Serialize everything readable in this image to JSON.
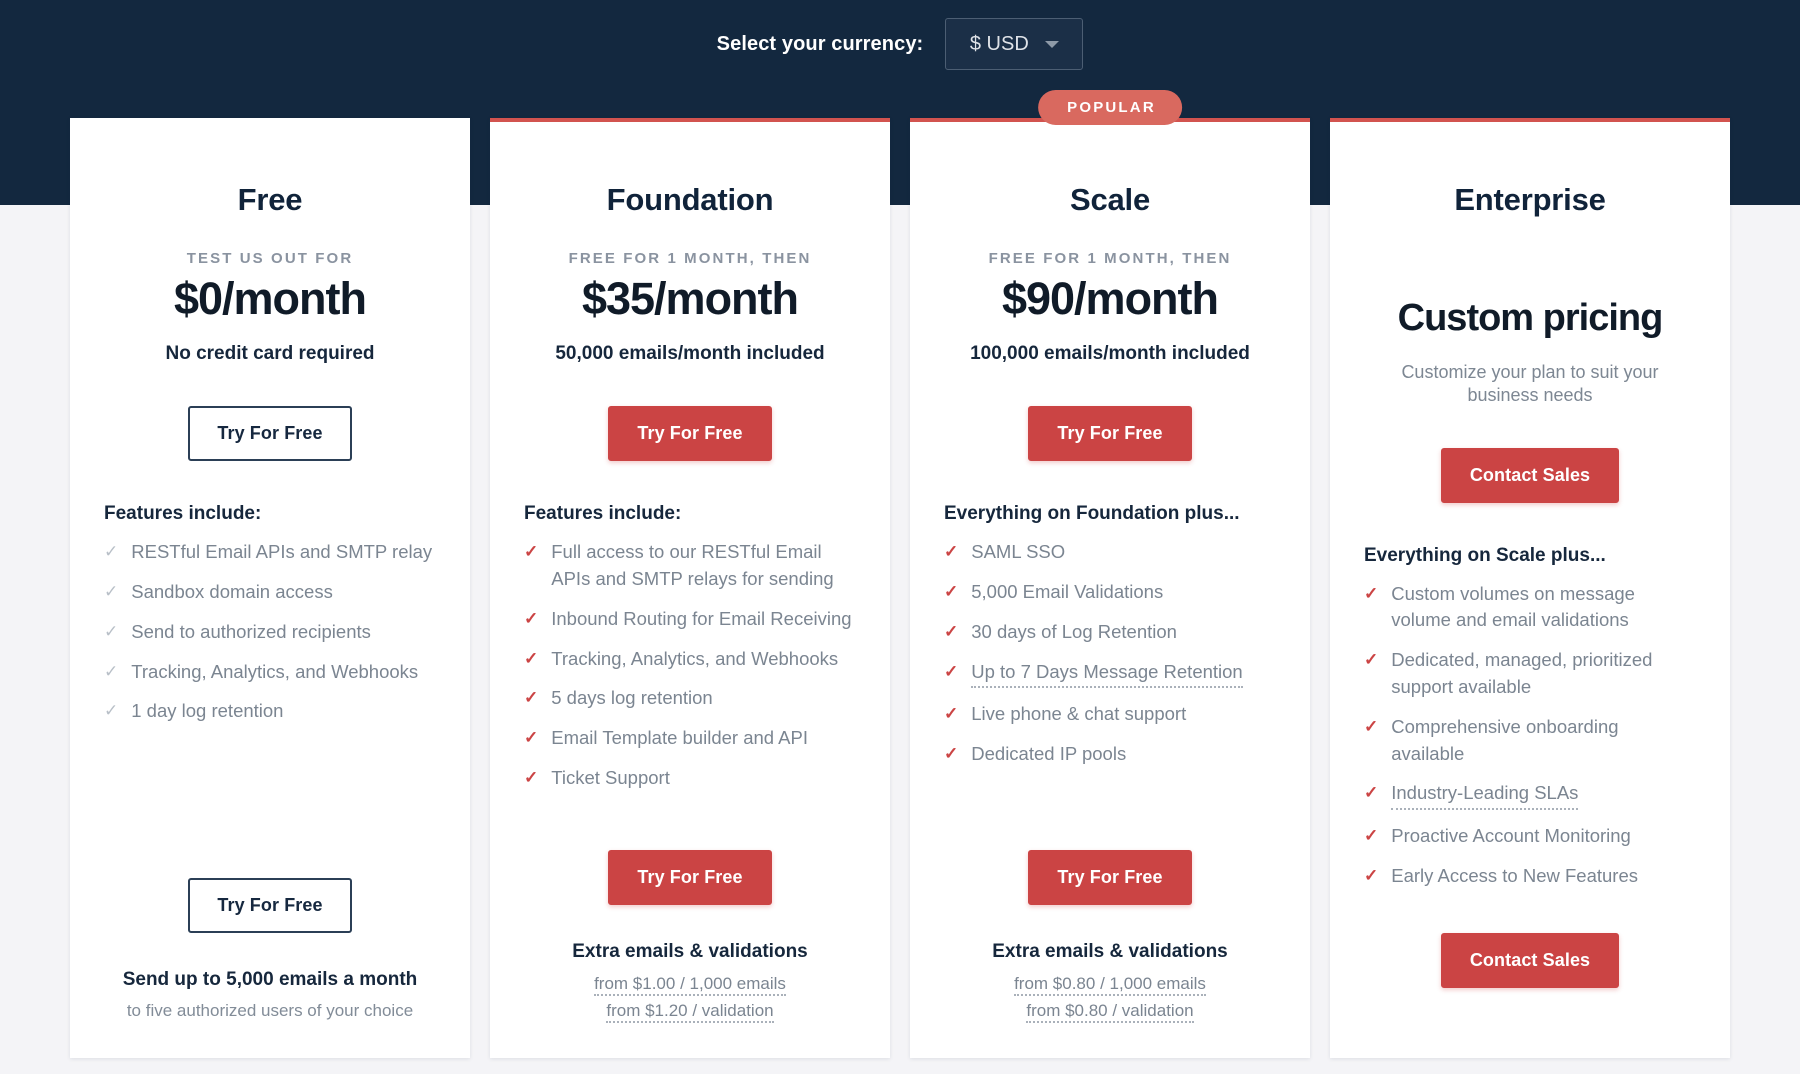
{
  "currency_bar": {
    "label": "Select your currency:",
    "selected": "$ USD",
    "caret_icon": "chevron-down-icon"
  },
  "colors": {
    "header_bg": "#13283f",
    "page_bg": "#f4f4f7",
    "accent_red": "#cb4444",
    "badge_red": "#d9695f",
    "card_top_border": "#d2534f",
    "muted_text": "#7b8591"
  },
  "plans": [
    {
      "name": "Free",
      "badge": null,
      "kicker": "Test us out for",
      "price": "$0/month",
      "price_note": "No credit card required",
      "price_note_style": "bold",
      "cta_top": "Try For Free",
      "cta_top_style": "outline",
      "features_title": "Features include:",
      "check_style": "muted",
      "features": [
        {
          "text": "RESTful Email APIs and SMTP relay",
          "tooltip": false
        },
        {
          "text": "Sandbox domain access",
          "tooltip": false
        },
        {
          "text": "Send to authorized recipients",
          "tooltip": false
        },
        {
          "text": "Tracking, Analytics, and Webhooks",
          "tooltip": false
        },
        {
          "text": "1 day log retention",
          "tooltip": false
        }
      ],
      "cta_bottom": "Try For Free",
      "cta_bottom_style": "outline",
      "footer_title": "Send up to 5,000 emails a month",
      "footer_sub": "to five authorized users of your choice",
      "footer_links": []
    },
    {
      "name": "Foundation",
      "badge": null,
      "kicker": "Free for 1 month, then",
      "price": "$35/month",
      "price_note": "50,000 emails/month included",
      "price_note_style": "bold",
      "cta_top": "Try For Free",
      "cta_top_style": "solid",
      "features_title": "Features include:",
      "check_style": "red",
      "features": [
        {
          "text": "Full access to our RESTful Email APIs and SMTP relays for sending",
          "tooltip": false
        },
        {
          "text": "Inbound Routing for Email Receiving",
          "tooltip": false
        },
        {
          "text": "Tracking, Analytics, and Webhooks",
          "tooltip": false
        },
        {
          "text": "5 days log retention",
          "tooltip": false
        },
        {
          "text": "Email Template builder and API",
          "tooltip": false
        },
        {
          "text": "Ticket Support",
          "tooltip": false
        }
      ],
      "cta_bottom": "Try For Free",
      "cta_bottom_style": "solid",
      "footer_title": "Extra emails & validations",
      "footer_sub": null,
      "footer_links": [
        "from $1.00 / 1,000 emails",
        "from $1.20 / validation"
      ]
    },
    {
      "name": "Scale",
      "badge": "POPULAR",
      "kicker": "Free for 1 month, then",
      "price": "$90/month",
      "price_note": "100,000 emails/month included",
      "price_note_style": "bold",
      "cta_top": "Try For Free",
      "cta_top_style": "solid",
      "features_title": "Everything on Foundation plus...",
      "check_style": "red",
      "features": [
        {
          "text": "SAML SSO",
          "tooltip": false
        },
        {
          "text": "5,000 Email Validations",
          "tooltip": false
        },
        {
          "text": "30 days of Log Retention",
          "tooltip": false
        },
        {
          "text": "Up to 7 Days Message Retention",
          "tooltip": true
        },
        {
          "text": "Live phone & chat support",
          "tooltip": false
        },
        {
          "text": "Dedicated IP pools",
          "tooltip": false
        }
      ],
      "cta_bottom": "Try For Free",
      "cta_bottom_style": "solid",
      "footer_title": "Extra emails & validations",
      "footer_sub": null,
      "footer_links": [
        "from $0.80 / 1,000 emails",
        "from $0.80 / validation"
      ]
    },
    {
      "name": "Enterprise",
      "badge": null,
      "kicker": "",
      "price": "Custom pricing",
      "price_note": "Customize your plan to suit your business needs",
      "price_note_style": "light",
      "cta_top": "Contact Sales",
      "cta_top_style": "solid",
      "features_title": "Everything on Scale plus...",
      "check_style": "red",
      "features": [
        {
          "text": "Custom volumes on message volume and email validations",
          "tooltip": false
        },
        {
          "text": "Dedicated, managed, prioritized support available",
          "tooltip": false
        },
        {
          "text": "Comprehensive onboarding available",
          "tooltip": false
        },
        {
          "text": "Industry-Leading SLAs",
          "tooltip": true
        },
        {
          "text": "Proactive Account Monitoring",
          "tooltip": false
        },
        {
          "text": "Early Access to New Features",
          "tooltip": false
        }
      ],
      "cta_bottom": "Contact Sales",
      "cta_bottom_style": "solid",
      "footer_title": null,
      "footer_sub": null,
      "footer_links": []
    }
  ]
}
